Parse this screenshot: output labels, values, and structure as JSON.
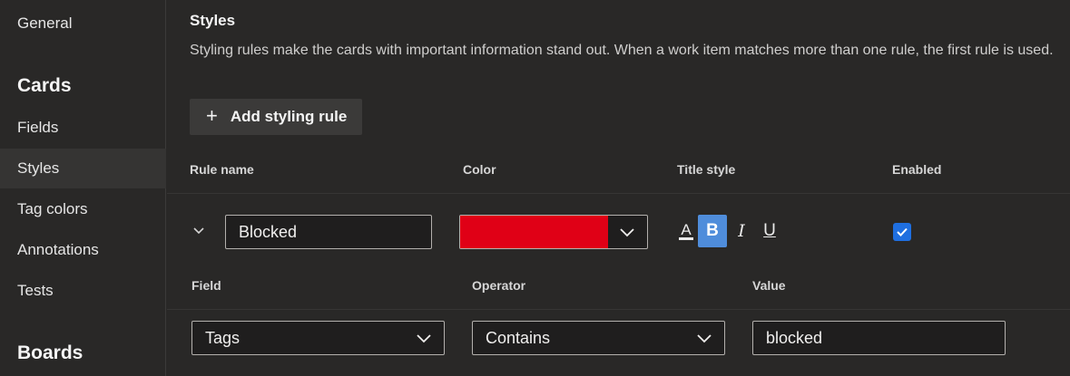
{
  "sidebar": {
    "items": [
      {
        "label": "General"
      },
      {
        "label": "Fields"
      },
      {
        "label": "Styles",
        "selected": true
      },
      {
        "label": "Tag colors"
      },
      {
        "label": "Annotations"
      },
      {
        "label": "Tests"
      }
    ],
    "headings": {
      "cards": "Cards",
      "boards": "Boards"
    }
  },
  "section": {
    "title": "Styles",
    "description": "Styling rules make the cards with important information stand out. When a work item matches more than one rule, the first rule is used.",
    "add_button_label": "Add styling rule",
    "add_icon": "+"
  },
  "rule_table": {
    "headers": {
      "rule_name": "Rule name",
      "color": "Color",
      "title_style": "Title style",
      "enabled": "Enabled"
    },
    "rule": {
      "name": "Blocked",
      "color": "#e00016",
      "title_style": {
        "font_color_glyph": "A",
        "bold_glyph": "B",
        "italic_glyph": "I",
        "underline_glyph": "U",
        "bold_active": true
      },
      "enabled": true
    }
  },
  "criteria": {
    "headers": {
      "field": "Field",
      "operator": "Operator",
      "value": "Value"
    },
    "field": "Tags",
    "operator": "Contains",
    "value": "blocked"
  },
  "colors": {
    "accent": "#4f8ddb",
    "checkbox": "#1f6fe0"
  }
}
